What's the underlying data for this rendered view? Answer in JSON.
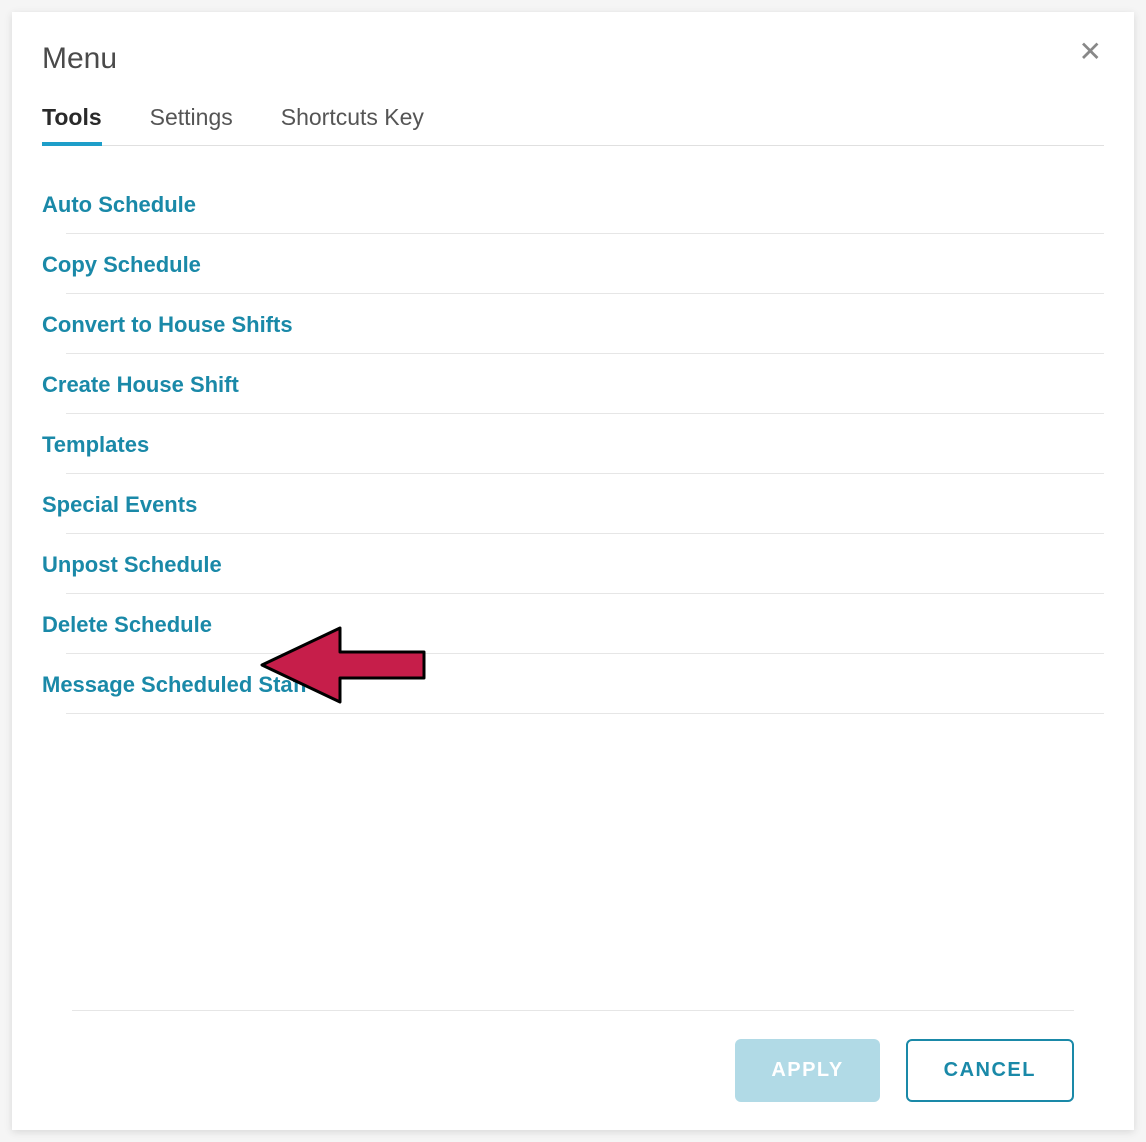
{
  "modal": {
    "title": "Menu",
    "close_symbol": "✕"
  },
  "tabs": [
    {
      "label": "Tools",
      "active": true
    },
    {
      "label": "Settings",
      "active": false
    },
    {
      "label": "Shortcuts Key",
      "active": false
    }
  ],
  "tools": [
    {
      "label": "Auto Schedule"
    },
    {
      "label": "Copy Schedule"
    },
    {
      "label": "Convert to House Shifts"
    },
    {
      "label": "Create House Shift"
    },
    {
      "label": "Templates"
    },
    {
      "label": "Special Events"
    },
    {
      "label": "Unpost Schedule"
    },
    {
      "label": "Delete Schedule"
    },
    {
      "label": "Message Scheduled Staff"
    }
  ],
  "annotation": {
    "target_index": 7,
    "color": "#c61e4a"
  },
  "footer": {
    "apply_label": "APPLY",
    "cancel_label": "CANCEL"
  },
  "colors": {
    "accent": "#1a89a8",
    "tab_underline": "#1e9ec9",
    "apply_bg": "#b1dae6"
  }
}
